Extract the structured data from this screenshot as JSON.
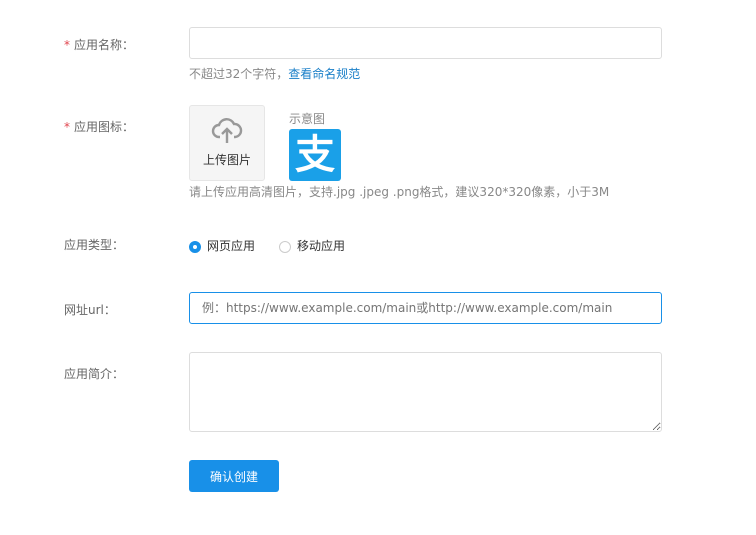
{
  "form": {
    "name": {
      "label": "应用名称：",
      "required": "*",
      "value": "",
      "hint": "不超过32个字符，",
      "hint_link": "查看命名规范"
    },
    "icon": {
      "label": "应用图标：",
      "required": "*",
      "upload_label": "上传图片",
      "example_label": "示意图",
      "hint": "请上传应用高清图片，支持.jpg .jpeg .png格式，建议320*320像素，小于3M"
    },
    "type": {
      "label": "应用类型：",
      "options": [
        {
          "label": "网页应用",
          "selected": true
        },
        {
          "label": "移动应用",
          "selected": false
        }
      ]
    },
    "url": {
      "label": "网址url：",
      "placeholder": "例：https://www.example.com/main或http://www.example.com/main"
    },
    "intro": {
      "label": "应用简介：",
      "value": ""
    },
    "submit": "确认创建"
  },
  "colors": {
    "accent": "#1890e8",
    "alipay": "#1aa0e8"
  }
}
